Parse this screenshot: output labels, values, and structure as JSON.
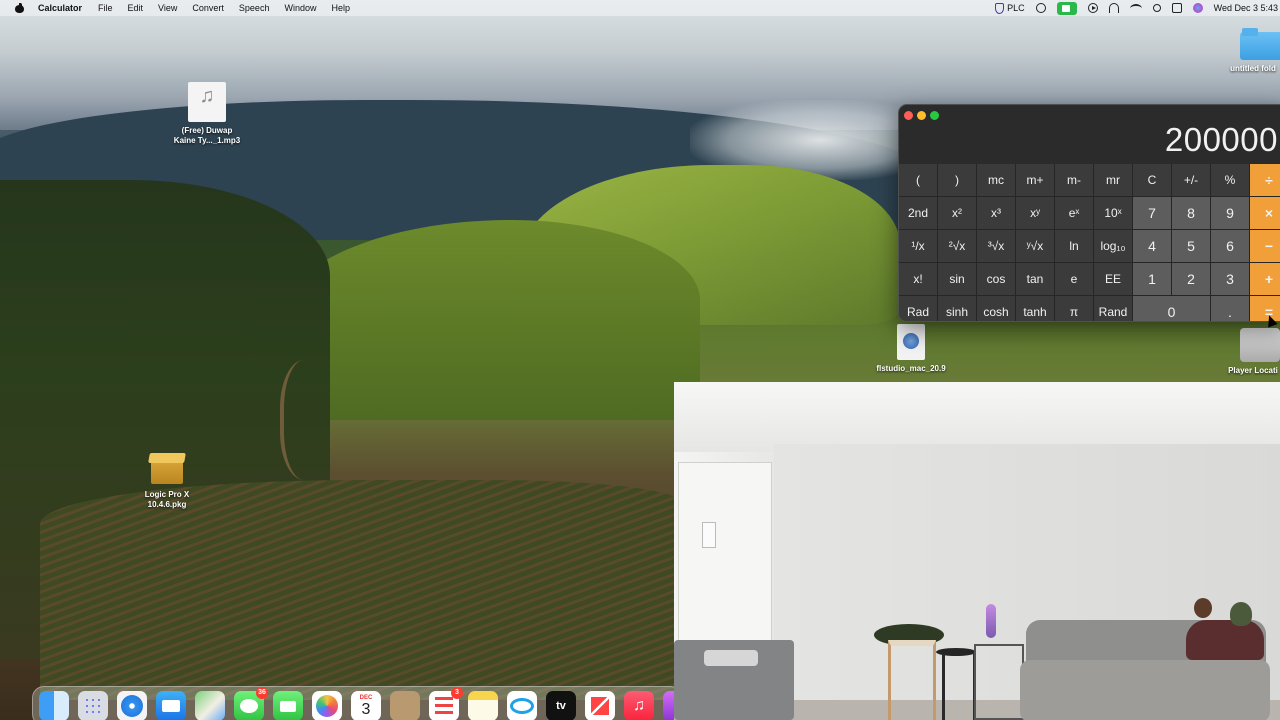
{
  "menubar": {
    "app_name": "Calculator",
    "menus": [
      "File",
      "Edit",
      "View",
      "Convert",
      "Speech",
      "Window",
      "Help"
    ],
    "plc_label": "PLC",
    "clock": "Wed Dec 3  5:43"
  },
  "desktop": {
    "icons": [
      {
        "name": "(Free) Duwap Kaine Ty..._1.mp3",
        "line1": "(Free) Duwap",
        "line2": "Kaine Ty..._1.mp3",
        "icon": "audio-file-icon"
      },
      {
        "name": "Logic Pro X 10.4.6.pkg",
        "line1": "Logic Pro X",
        "line2": "10.4.6.pkg",
        "icon": "package-icon"
      },
      {
        "name": "untitled folder",
        "line1": "untitled fold",
        "line2": "",
        "icon": "folder-icon"
      },
      {
        "name": "flstudio_mac_20.9",
        "line1": "flstudio_mac_20.9",
        "line2": "",
        "icon": "installer-file-icon"
      },
      {
        "name": "Player Location",
        "line1": "Player Locati",
        "line2": "",
        "icon": "disk-icon"
      }
    ]
  },
  "calculator": {
    "display": "200000",
    "rows": [
      [
        "(",
        ")",
        "mc",
        "m+",
        "m-",
        "mr",
        "C",
        "+/-",
        "%",
        "÷"
      ],
      [
        "2nd",
        "x²",
        "x³",
        "xʸ",
        "eˣ",
        "10ˣ",
        "7",
        "8",
        "9",
        "×"
      ],
      [
        "¹/x",
        "²√x",
        "³√x",
        "ʸ√x",
        "ln",
        "log₁₀",
        "4",
        "5",
        "6",
        "−"
      ],
      [
        "x!",
        "sin",
        "cos",
        "tan",
        "e",
        "EE",
        "1",
        "2",
        "3",
        "+"
      ],
      [
        "Rad",
        "sinh",
        "cosh",
        "tanh",
        "π",
        "Rand",
        "0",
        ".",
        "="
      ]
    ]
  },
  "dock": {
    "items": [
      {
        "name": "finder",
        "label": ""
      },
      {
        "name": "launchpad",
        "label": ""
      },
      {
        "name": "safari",
        "label": ""
      },
      {
        "name": "mail",
        "label": ""
      },
      {
        "name": "maps",
        "label": ""
      },
      {
        "name": "messages",
        "label": "",
        "badge": "36"
      },
      {
        "name": "facetime",
        "label": ""
      },
      {
        "name": "photos",
        "label": ""
      },
      {
        "name": "calendar",
        "month": "DEC",
        "day": "3"
      },
      {
        "name": "contacts",
        "label": ""
      },
      {
        "name": "reminders",
        "label": "",
        "badge": "3"
      },
      {
        "name": "notes",
        "label": ""
      },
      {
        "name": "freeform",
        "label": ""
      },
      {
        "name": "apple-tv",
        "label": "tv"
      },
      {
        "name": "news",
        "label": ""
      },
      {
        "name": "music",
        "label": ""
      },
      {
        "name": "podcasts",
        "label": ""
      }
    ]
  },
  "colors": {
    "operator_key": "#f19f38",
    "number_key": "#5d5d5d",
    "function_key": "#3b3b3b",
    "calc_background": "#2b2b2b"
  }
}
